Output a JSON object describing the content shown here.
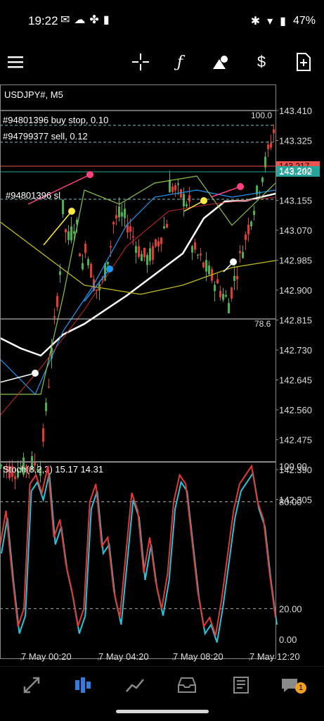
{
  "status_bar": {
    "time": "19:22",
    "battery": "47%"
  },
  "toolbar": {
    "icons": [
      "menu-icon",
      "crosshair-icon",
      "function-icon",
      "objects-icon",
      "symbol-dollar-icon",
      "new-order-icon"
    ]
  },
  "chart": {
    "symbol_label": "USDJPY#, M5",
    "price_ticks": [
      "143.410",
      "143.325",
      "143.240",
      "143.155",
      "143.070",
      "142.985",
      "142.900",
      "142.815",
      "142.730",
      "142.645",
      "142.560",
      "142.475",
      "142.390",
      "142.305"
    ],
    "price_badge_bid": "143.202",
    "price_badge_ask": "143.217",
    "order_lines": [
      "#94801396 buy stop, 0.10",
      "#94799377 sell, 0.12",
      "#94801396 sl"
    ],
    "fib_top": "100.0",
    "fib_bottom": "78.6",
    "time_labels": [
      "7 May 00:20",
      "7 May 04:20",
      "7 May 08:20",
      "7 May 12:20"
    ]
  },
  "stoch": {
    "label": "Stoch(8,2,3) 15.17 14.31",
    "ticks": [
      "100.00",
      "80.00",
      "20.00",
      "0.00"
    ]
  },
  "colors": {
    "up": "#4caf50",
    "down": "#e53935",
    "bid": "#26a69a",
    "ask": "#ef5350",
    "accent": "#2f7de0"
  },
  "tabs": [
    {
      "name": "quotes",
      "icon": "quotes-icon"
    },
    {
      "name": "chart",
      "icon": "chart-icon",
      "active": true
    },
    {
      "name": "trade",
      "icon": "trade-icon"
    },
    {
      "name": "history",
      "icon": "history-icon"
    },
    {
      "name": "news",
      "icon": "news-icon"
    },
    {
      "name": "messages",
      "icon": "messages-icon",
      "badge": "1"
    }
  ]
}
